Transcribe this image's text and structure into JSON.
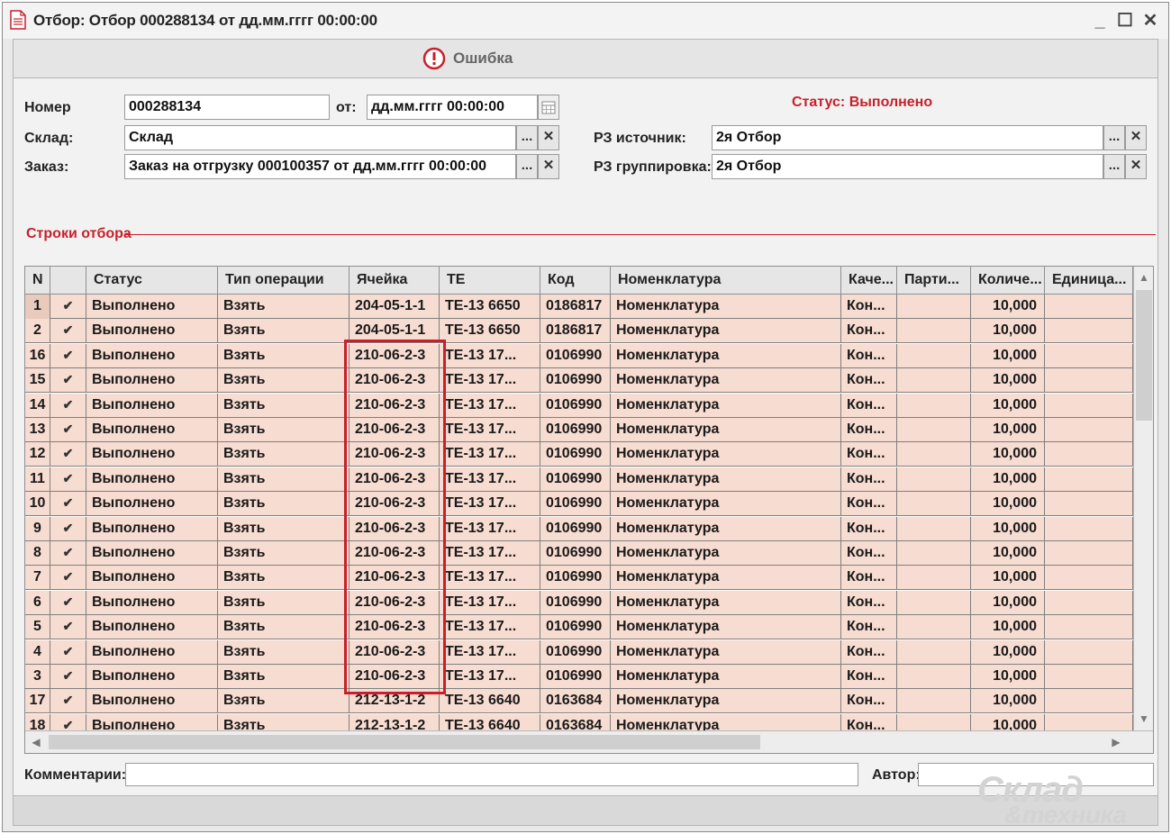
{
  "window": {
    "title": "Отбор: Отбор  000288134 от дд.мм.гггг 00:00:00",
    "minimize": "_",
    "maximize": "☐",
    "close": "✕"
  },
  "toolbar": {
    "error_label": "Ошибка"
  },
  "form": {
    "number_label": "Номер",
    "number_value": "000288134",
    "from_label": "от:",
    "date_value": "дд.мм.гггг 00:00:00",
    "warehouse_label": "Склад:",
    "warehouse_value": "Склад",
    "order_label": "Заказ:",
    "order_value": "Заказ на отгрузку 000100357 от дд.мм.гггг 00:00:00",
    "status_text": "Статус: Выполнено",
    "source_zone_label": "РЗ источник:",
    "source_zone_value": "2я Отбор",
    "grouping_zone_label": "РЗ группировка:",
    "grouping_zone_value": "2я Отбор",
    "select_btn": "...",
    "clear_btn": "✕"
  },
  "section": {
    "title": "Строки отбора"
  },
  "table": {
    "columns": [
      "N",
      "",
      "Статус",
      "Тип операции",
      "Ячейка",
      "ТЕ",
      "Код",
      "Номенклатура",
      "Каче...",
      "Парти...",
      "Количе...",
      "Единица..."
    ],
    "rows": [
      {
        "n": "1",
        "status": "Выполнено",
        "op": "Взять",
        "cell": "204-05-1-1",
        "te": "ТЕ-13 6650",
        "code": "0186817",
        "nom": "Номенклатура",
        "qual": "Кон...",
        "batch": "",
        "qty": "10,000",
        "unit": ""
      },
      {
        "n": "2",
        "status": "Выполнено",
        "op": "Взять",
        "cell": "204-05-1-1",
        "te": "ТЕ-13 6650",
        "code": "0186817",
        "nom": "Номенклатура",
        "qual": "Кон...",
        "batch": "",
        "qty": "10,000",
        "unit": ""
      },
      {
        "n": "16",
        "status": "Выполнено",
        "op": "Взять",
        "cell": "210-06-2-3",
        "te": "ТЕ-13 17...",
        "code": "0106990",
        "nom": "Номенклатура",
        "qual": "Кон...",
        "batch": "",
        "qty": "10,000",
        "unit": ""
      },
      {
        "n": "15",
        "status": "Выполнено",
        "op": "Взять",
        "cell": "210-06-2-3",
        "te": "ТЕ-13 17...",
        "code": "0106990",
        "nom": "Номенклатура",
        "qual": "Кон...",
        "batch": "",
        "qty": "10,000",
        "unit": ""
      },
      {
        "n": "14",
        "status": "Выполнено",
        "op": "Взять",
        "cell": "210-06-2-3",
        "te": "ТЕ-13 17...",
        "code": "0106990",
        "nom": "Номенклатура",
        "qual": "Кон...",
        "batch": "",
        "qty": "10,000",
        "unit": ""
      },
      {
        "n": "13",
        "status": "Выполнено",
        "op": "Взять",
        "cell": "210-06-2-3",
        "te": "ТЕ-13 17...",
        "code": "0106990",
        "nom": "Номенклатура",
        "qual": "Кон...",
        "batch": "",
        "qty": "10,000",
        "unit": ""
      },
      {
        "n": "12",
        "status": "Выполнено",
        "op": "Взять",
        "cell": "210-06-2-3",
        "te": "ТЕ-13 17...",
        "code": "0106990",
        "nom": "Номенклатура",
        "qual": "Кон...",
        "batch": "",
        "qty": "10,000",
        "unit": ""
      },
      {
        "n": "11",
        "status": "Выполнено",
        "op": "Взять",
        "cell": "210-06-2-3",
        "te": "ТЕ-13 17...",
        "code": "0106990",
        "nom": "Номенклатура",
        "qual": "Кон...",
        "batch": "",
        "qty": "10,000",
        "unit": ""
      },
      {
        "n": "10",
        "status": "Выполнено",
        "op": "Взять",
        "cell": "210-06-2-3",
        "te": "ТЕ-13 17...",
        "code": "0106990",
        "nom": "Номенклатура",
        "qual": "Кон...",
        "batch": "",
        "qty": "10,000",
        "unit": ""
      },
      {
        "n": "9",
        "status": "Выполнено",
        "op": "Взять",
        "cell": "210-06-2-3",
        "te": "ТЕ-13 17...",
        "code": "0106990",
        "nom": "Номенклатура",
        "qual": "Кон...",
        "batch": "",
        "qty": "10,000",
        "unit": ""
      },
      {
        "n": "8",
        "status": "Выполнено",
        "op": "Взять",
        "cell": "210-06-2-3",
        "te": "ТЕ-13 17...",
        "code": "0106990",
        "nom": "Номенклатура",
        "qual": "Кон...",
        "batch": "",
        "qty": "10,000",
        "unit": ""
      },
      {
        "n": "7",
        "status": "Выполнено",
        "op": "Взять",
        "cell": "210-06-2-3",
        "te": "ТЕ-13 17...",
        "code": "0106990",
        "nom": "Номенклатура",
        "qual": "Кон...",
        "batch": "",
        "qty": "10,000",
        "unit": ""
      },
      {
        "n": "6",
        "status": "Выполнено",
        "op": "Взять",
        "cell": "210-06-2-3",
        "te": "ТЕ-13 17...",
        "code": "0106990",
        "nom": "Номенклатура",
        "qual": "Кон...",
        "batch": "",
        "qty": "10,000",
        "unit": ""
      },
      {
        "n": "5",
        "status": "Выполнено",
        "op": "Взять",
        "cell": "210-06-2-3",
        "te": "ТЕ-13 17...",
        "code": "0106990",
        "nom": "Номенклатура",
        "qual": "Кон...",
        "batch": "",
        "qty": "10,000",
        "unit": ""
      },
      {
        "n": "4",
        "status": "Выполнено",
        "op": "Взять",
        "cell": "210-06-2-3",
        "te": "ТЕ-13 17...",
        "code": "0106990",
        "nom": "Номенклатура",
        "qual": "Кон...",
        "batch": "",
        "qty": "10,000",
        "unit": ""
      },
      {
        "n": "3",
        "status": "Выполнено",
        "op": "Взять",
        "cell": "210-06-2-3",
        "te": "ТЕ-13 17...",
        "code": "0106990",
        "nom": "Номенклатура",
        "qual": "Кон...",
        "batch": "",
        "qty": "10,000",
        "unit": ""
      },
      {
        "n": "17",
        "status": "Выполнено",
        "op": "Взять",
        "cell": "212-13-1-2",
        "te": "ТЕ-13 6640",
        "code": "0163684",
        "nom": "Номенклатура",
        "qual": "Кон...",
        "batch": "",
        "qty": "10,000",
        "unit": ""
      },
      {
        "n": "18",
        "status": "Выполнено",
        "op": "Взять",
        "cell": "212-13-1-2",
        "te": "ТЕ-13 6640",
        "code": "0163684",
        "nom": "Номенклатура",
        "qual": "Кон...",
        "batch": "",
        "qty": "10,000",
        "unit": ""
      }
    ],
    "check_glyph": "✔"
  },
  "bottom": {
    "comment_label": "Комментарии:",
    "comment_value": "",
    "author_label": "Автор:",
    "author_value": ""
  },
  "watermark": {
    "line1": "Склад",
    "line2": "&техника"
  },
  "colors": {
    "accent_red": "#c8202a",
    "row_bg": "#f7dcd1"
  }
}
